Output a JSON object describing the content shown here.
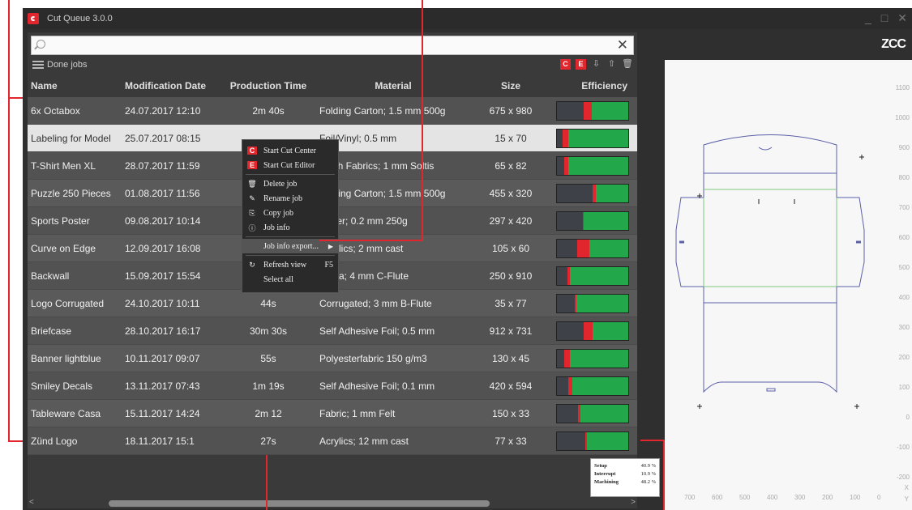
{
  "window": {
    "title": "Cut Queue 3.0.0",
    "controls": [
      "_",
      "□",
      "✕"
    ]
  },
  "search": {
    "placeholder": "",
    "value": "",
    "clear": "✕"
  },
  "toolbar": {
    "label": "Done jobs",
    "icons": [
      "start-cut-center-icon",
      "start-cut-editor-icon",
      "export-icon",
      "import-icon",
      "delete-icon"
    ]
  },
  "columns": [
    "Name",
    "Modification Date",
    "Production Time",
    "Material",
    "Size",
    "Efficiency"
  ],
  "jobs": [
    {
      "name": "6x Octabox",
      "date": "24.07.2017  12:10",
      "time": "2m 40s",
      "material": "Folding Carton; 1.5 mm 500g",
      "size": "675 x 980",
      "setup": 0.37,
      "interrupt": 0.12,
      "machining": 0.51
    },
    {
      "name": "Labeling for Model",
      "date": "25.07.2017  08:15",
      "time": "",
      "material": "Foil/Vinyl; 0.5 mm",
      "size": "15 x 70",
      "setup": 0.08,
      "interrupt": 0.08,
      "machining": 0.84,
      "selected": true
    },
    {
      "name": "T-Shirt Men XL",
      "date": "28.07.2017  11:59",
      "time": "",
      "material": "Mesh Fabrics; 1 mm Soltis",
      "size": "65 x 82",
      "setup": 0.1,
      "interrupt": 0.06,
      "machining": 0.84
    },
    {
      "name": "Puzzle 250 Pieces",
      "date": "01.08.2017  11:56",
      "time": "",
      "material": "Folding Carton; 1.5 mm 500g",
      "size": "455 x 320",
      "setup": 0.5,
      "interrupt": 0.04,
      "machining": 0.46
    },
    {
      "name": "Sports Poster",
      "date": "09.08.2017  10:14",
      "time": "",
      "material": "Paper; 0.2 mm 250g",
      "size": "297 x 420",
      "setup": 0.36,
      "interrupt": 0.02,
      "machining": 0.62
    },
    {
      "name": "Curve on Edge",
      "date": "12.09.2017  16:08",
      "time": "",
      "material": "Acrylics; 2 mm cast",
      "size": "105 x 60",
      "setup": 0.28,
      "interrupt": 0.18,
      "machining": 0.54
    },
    {
      "name": "Backwall",
      "date": "15.09.2017  15:54",
      "time": "",
      "material": "Dispa; 4 mm C-Flute",
      "size": "250 x 910",
      "setup": 0.15,
      "interrupt": 0.03,
      "machining": 0.82
    },
    {
      "name": "Logo Corrugated",
      "date": "24.10.2017  10:11",
      "time": "44s",
      "material": "Corrugated; 3 mm B-Flute",
      "size": "35 x 77",
      "setup": 0.25,
      "interrupt": 0.02,
      "machining": 0.73
    },
    {
      "name": "Briefcase",
      "date": "28.10.2017  16:17",
      "time": "30m 30s",
      "material": "Self Adhesive Foil; 0.5 mm",
      "size": "912 x 731",
      "setup": 0.38,
      "interrupt": 0.12,
      "machining": 0.5
    },
    {
      "name": "Banner lightblue",
      "date": "10.11.2017  09:07",
      "time": "55s",
      "material": "Polyesterfabric 150 g/m3",
      "size": "130 x 45",
      "setup": 0.1,
      "interrupt": 0.08,
      "machining": 0.82
    },
    {
      "name": "Smiley Decals",
      "date": "13.11.2017  07:43",
      "time": "1m 19s",
      "material": "Self Adhesive Foil; 0.1 mm",
      "size": "420 x 594",
      "setup": 0.16,
      "interrupt": 0.06,
      "machining": 0.78
    },
    {
      "name": "Tableware Casa",
      "date": "15.11.2017  14:24",
      "time": "2m 12",
      "material": "Fabric; 1 mm Felt",
      "size": "150 x 33",
      "setup": 0.3,
      "interrupt": 0.03,
      "machining": 0.67
    },
    {
      "name": "Zünd Logo",
      "date": "18.11.2017  15:1",
      "time": "27s",
      "material": "Acrylics; 12 mm cast",
      "size": "77 x 33",
      "setup": 0.4,
      "interrupt": 0.02,
      "machining": 0.58
    }
  ],
  "context_menu": [
    {
      "label": "Start Cut Center",
      "icon": "C",
      "icon_name": "cut-center-icon"
    },
    {
      "label": "Start Cut Editor",
      "icon": "E",
      "icon_name": "cut-editor-icon"
    },
    {
      "label": "Delete job",
      "icon": "🗑",
      "icon_name": "trash-icon"
    },
    {
      "label": "Rename job",
      "icon": "✎",
      "icon_name": "pencil-icon"
    },
    {
      "label": "Copy job",
      "icon": "⎘",
      "icon_name": "copy-icon"
    },
    {
      "label": "Job info",
      "icon": "ⓘ",
      "icon_name": "info-icon"
    },
    {
      "label": "Job info export...",
      "icon": "",
      "icon_name": "",
      "highlighted": true,
      "submenu": true
    },
    {
      "label": "Refresh view",
      "icon": "↻",
      "icon_name": "refresh-icon",
      "shortcut": "F5"
    },
    {
      "label": "Select all",
      "icon": "",
      "icon_name": ""
    }
  ],
  "tooltip": {
    "rows": [
      {
        "label": "Setup",
        "value": "40.9 %"
      },
      {
        "label": "Interrupt",
        "value": "10.9 %"
      },
      {
        "label": "Machining",
        "value": "48.2 %"
      }
    ]
  },
  "preview": {
    "logo": "ZCC",
    "ruler_v": [
      "1100",
      "1000",
      "900",
      "800",
      "700",
      "600",
      "500",
      "400",
      "300",
      "200",
      "100",
      "0",
      "-100",
      "-200"
    ],
    "ruler_h": [
      "700",
      "600",
      "500",
      "400",
      "300",
      "200",
      "100",
      "0"
    ],
    "axis_x": "X",
    "axis_y": "Y"
  },
  "colors": {
    "setup": "#3e4248",
    "interrupt": "#e2262d",
    "machining": "#22a84a",
    "brand": "#e2262d",
    "outline": "#5b5fa8",
    "crease": "#7ec97e"
  }
}
